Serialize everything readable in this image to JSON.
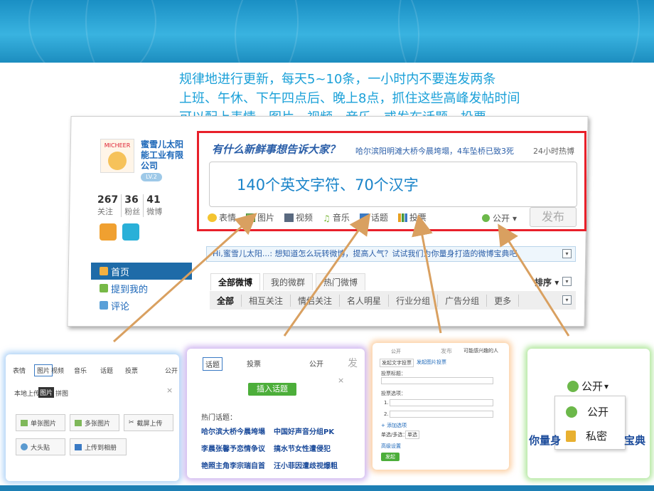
{
  "tips": [
    "规律地进行更新，每天5~10条，一小时内不要连发两条",
    "上班、午休、下午四点后、晚上8点，抓住这些高峰发帖时间",
    "可以配上表情，图片，视频，音乐，或发布话题，投票"
  ],
  "profile": {
    "name": "蜜雪儿太阳能工业有限公司",
    "level": "LV.2",
    "stats": [
      {
        "num": "267",
        "label": "关注"
      },
      {
        "num": "36",
        "label": "粉丝"
      },
      {
        "num": "41",
        "label": "微博"
      }
    ]
  },
  "nav": [
    {
      "label": "首页"
    },
    {
      "label": "提到我的"
    },
    {
      "label": "评论"
    }
  ],
  "compose": {
    "prompt": "有什么新鲜事想告诉大家？",
    "hot_topic": "哈尔滨阳明滩大桥今晨垮塌，4车坠桥已致3死",
    "hot_label": "24小时热博",
    "placeholder": "140个英文字符、70个汉字",
    "tools": [
      {
        "label": "表情",
        "icon": "smile-icon"
      },
      {
        "label": "图片",
        "icon": "picture-icon"
      },
      {
        "label": "视频",
        "icon": "video-icon"
      },
      {
        "label": "音乐",
        "icon": "music-icon"
      },
      {
        "label": "话题",
        "icon": "topic-icon"
      },
      {
        "label": "投票",
        "icon": "vote-icon"
      }
    ],
    "visibility": "公开",
    "submit": "发布"
  },
  "hint": "Hi,蜜雪儿太阳...: 想知道怎么玩转微博，提高人气？试试我们为你量身打造的微博宝典吧",
  "feed_tabs": [
    "全部微博",
    "我的微群",
    "热门微博"
  ],
  "sort_label": "排序",
  "filters": [
    "全部",
    "相互关注",
    "情侣关注",
    "名人明星",
    "行业分组",
    "广告分组",
    "更多"
  ],
  "shots": {
    "picture": {
      "toolbar": [
        "表情",
        "图片",
        "视频",
        "音乐",
        "话题",
        "投票",
        "公开"
      ],
      "tab_local": "本地上传",
      "tab_label": "图片",
      "tab_poster": "拼图",
      "close": "×",
      "buttons": [
        "单张图片",
        "多张图片",
        "截屏上传",
        "大头贴",
        "上传到相册"
      ]
    },
    "topic": {
      "toolbar": [
        "话题",
        "投票",
        "公开",
        "发"
      ],
      "close": "×",
      "insert": "插入话题",
      "hot_title": "热门话题：",
      "items": [
        "哈尔滨大桥今晨垮塌",
        "中国好声音分组PK",
        "李晨张馨予恋情争议",
        "搞水节女性遭侵犯",
        "艳照主角李宗瑞自首",
        "汪小菲因遭歧视爆粗"
      ]
    },
    "vote": {
      "toolbar": [
        "公开",
        "发布",
        "可能感兴趣的人"
      ],
      "tabs": [
        "发起文字投票",
        "发起图片投票"
      ],
      "fields": [
        "投票标题：",
        "投票选项：",
        "1.",
        "2.",
        "+ 添加选项",
        "单选/多选：",
        "单选",
        "高级设置"
      ],
      "submit": "发起"
    },
    "privacy": {
      "current": "公开",
      "options": [
        "公开",
        "私密"
      ],
      "bg_left": "你量身",
      "bg_right": "宝典"
    }
  }
}
